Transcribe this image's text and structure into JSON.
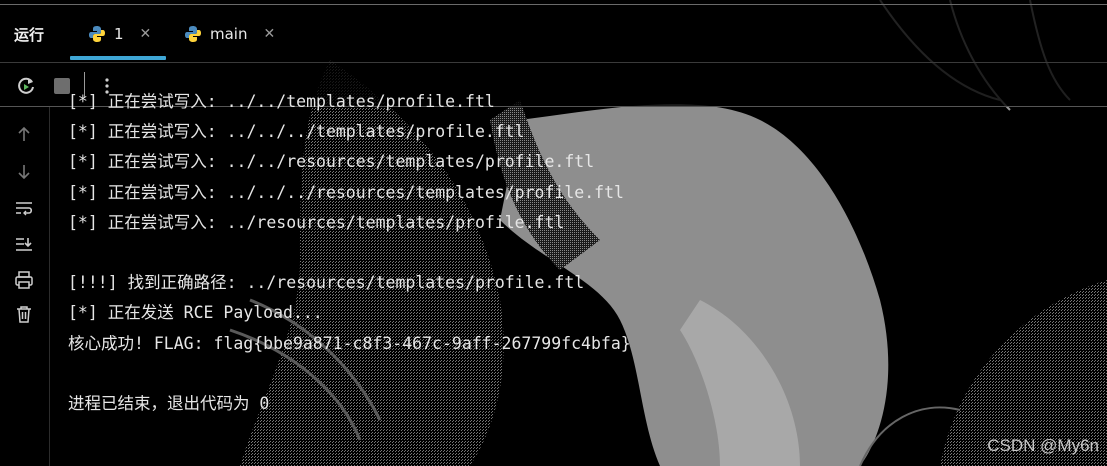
{
  "panel": {
    "title": "运行"
  },
  "tabs": [
    {
      "label": "1"
    },
    {
      "label": "main"
    }
  ],
  "console": {
    "lines": [
      "[*] 正在尝试写入: ../../templates/profile.ftl",
      "[*] 正在尝试写入: ../../../templates/profile.ftl",
      "[*] 正在尝试写入: ../../resources/templates/profile.ftl",
      "[*] 正在尝试写入: ../../../resources/templates/profile.ftl",
      "[*] 正在尝试写入: ../resources/templates/profile.ftl",
      "",
      "[!!!] 找到正确路径: ../resources/templates/profile.ftl",
      "[*] 正在发送 RCE Payload...",
      "核心成功! FLAG: flag{bbe9a871-c8f3-467c-9aff-267799fc4bfa}",
      "",
      "进程已结束，退出代码为 0"
    ]
  },
  "watermark": "CSDN @My6n",
  "colors": {
    "tab_accent": "#3fa7d6",
    "background": "#000000",
    "text": "#e6e6e6"
  },
  "icons": {
    "toolbar": [
      "rerun-icon",
      "stop-icon",
      "more-options-icon"
    ],
    "sidebar": [
      "arrow-up-icon",
      "arrow-down-icon",
      "soft-wrap-icon",
      "scroll-to-end-icon",
      "print-icon",
      "trash-icon"
    ]
  }
}
